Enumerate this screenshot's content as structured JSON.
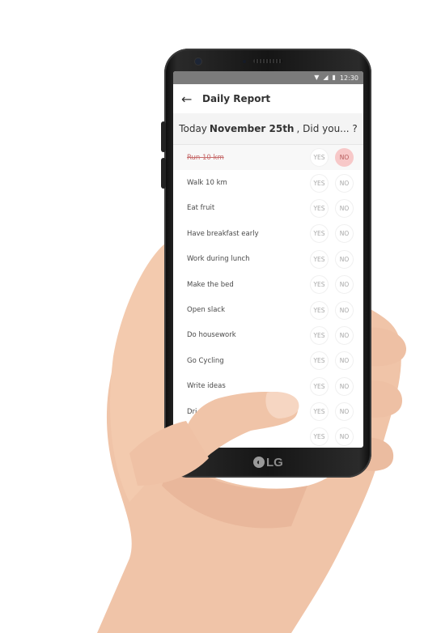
{
  "status_bar": {
    "time": "12:30",
    "icons": [
      "wifi-icon",
      "signal-icon",
      "battery-icon"
    ]
  },
  "header": {
    "title": "Daily Report",
    "back_icon": "arrow-left-icon"
  },
  "prompt": {
    "prefix": "Today",
    "date": "November 25th",
    "suffix": ", Did you... ?"
  },
  "choices": {
    "yes": "YES",
    "no": "NO"
  },
  "tasks": [
    {
      "label": "Run 10 km",
      "answer": "NO"
    },
    {
      "label": "Walk 10 km",
      "answer": ""
    },
    {
      "label": "Eat fruit",
      "answer": ""
    },
    {
      "label": "Have breakfast early",
      "answer": ""
    },
    {
      "label": "Work during lunch",
      "answer": ""
    },
    {
      "label": "Make the bed",
      "answer": ""
    },
    {
      "label": "Open slack",
      "answer": ""
    },
    {
      "label": "Do housework",
      "answer": ""
    },
    {
      "label": "Go Cycling",
      "answer": ""
    },
    {
      "label": "Write ideas",
      "answer": ""
    },
    {
      "label": "Dri",
      "answer": ""
    },
    {
      "label": "",
      "answer": ""
    }
  ],
  "device": {
    "brand": "LG"
  },
  "colors": {
    "no_active_bg": "#f7c8c8",
    "done_text": "#c66a6a",
    "status_bar": "#7b7b7b"
  }
}
